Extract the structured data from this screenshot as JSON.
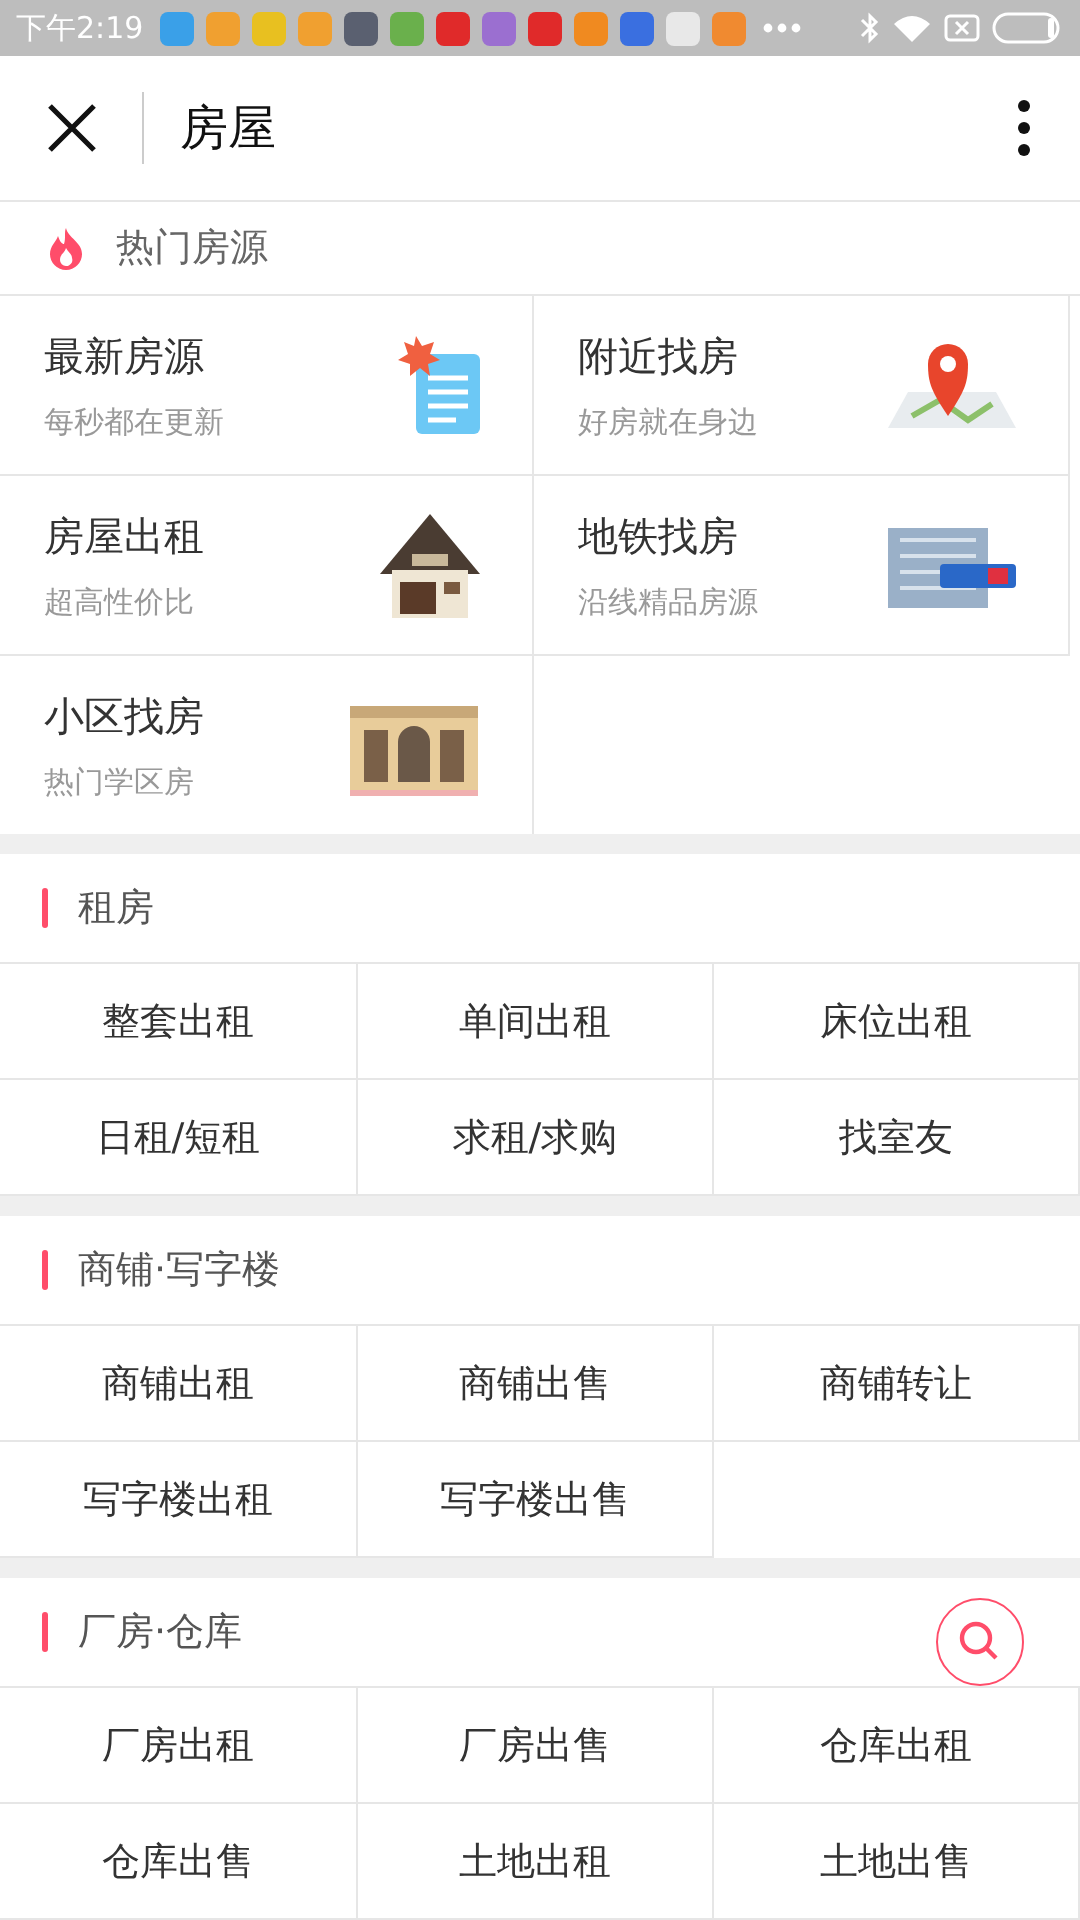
{
  "status_bar": {
    "time": "下午2:19",
    "notifications": [
      {
        "color": "#3aa0e8"
      },
      {
        "color": "#f0a030"
      },
      {
        "color": "#e8c020"
      },
      {
        "color": "#f0a030"
      },
      {
        "color": "#5a6070"
      },
      {
        "color": "#6ab04c"
      },
      {
        "color": "#e02a2a"
      },
      {
        "color": "#9b6fd0"
      },
      {
        "color": "#e02a2a"
      },
      {
        "color": "#f08a20"
      },
      {
        "color": "#3a6fe0"
      },
      {
        "color": "#e8e8e8"
      },
      {
        "color": "#f08a30"
      }
    ]
  },
  "header": {
    "title": "房屋"
  },
  "hot": {
    "title": "热门房源",
    "items": [
      {
        "title": "最新房源",
        "subtitle": "每秒都在更新",
        "kind": "document"
      },
      {
        "title": "附近找房",
        "subtitle": "好房就在身边",
        "kind": "map"
      },
      {
        "title": "房屋出租",
        "subtitle": "超高性价比",
        "kind": "house"
      },
      {
        "title": "地铁找房",
        "subtitle": "沿线精品房源",
        "kind": "building"
      },
      {
        "title": "小区找房",
        "subtitle": "热门学区房",
        "kind": "mansion"
      }
    ]
  },
  "sections": [
    {
      "title": "租房",
      "items": [
        "整套出租",
        "单间出租",
        "床位出租",
        "日租/短租",
        "求租/求购",
        "找室友"
      ]
    },
    {
      "title": "商铺·写字楼",
      "items": [
        "商铺出租",
        "商铺出售",
        "商铺转让",
        "写字楼出租",
        "写字楼出售"
      ]
    },
    {
      "title": "厂房·仓库",
      "items": [
        "厂房出租",
        "厂房出售",
        "仓库出租",
        "仓库出售",
        "土地出租",
        "土地出售"
      ]
    }
  ]
}
